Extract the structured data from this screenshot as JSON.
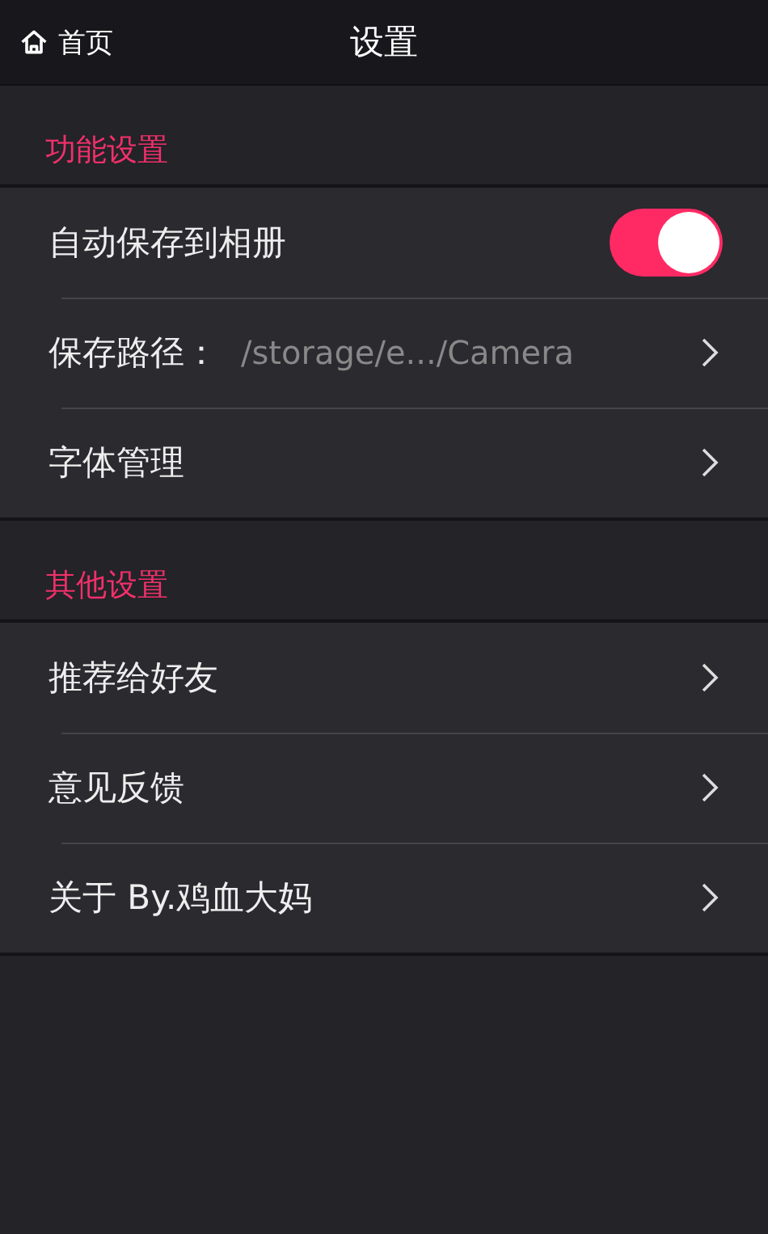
{
  "header": {
    "back_label": "首页",
    "title": "设置"
  },
  "sections": [
    {
      "title": "功能设置",
      "items": [
        {
          "kind": "toggle",
          "label": "自动保存到相册",
          "on": true
        },
        {
          "kind": "value",
          "label": "保存路径：",
          "value": "/storage/e.../Camera"
        },
        {
          "kind": "link",
          "label": "字体管理"
        }
      ]
    },
    {
      "title": "其他设置",
      "items": [
        {
          "kind": "link",
          "label": "推荐给好友"
        },
        {
          "kind": "link",
          "label": "意见反馈"
        },
        {
          "kind": "link",
          "label": "关于 By.鸡血大妈"
        }
      ]
    }
  ]
}
